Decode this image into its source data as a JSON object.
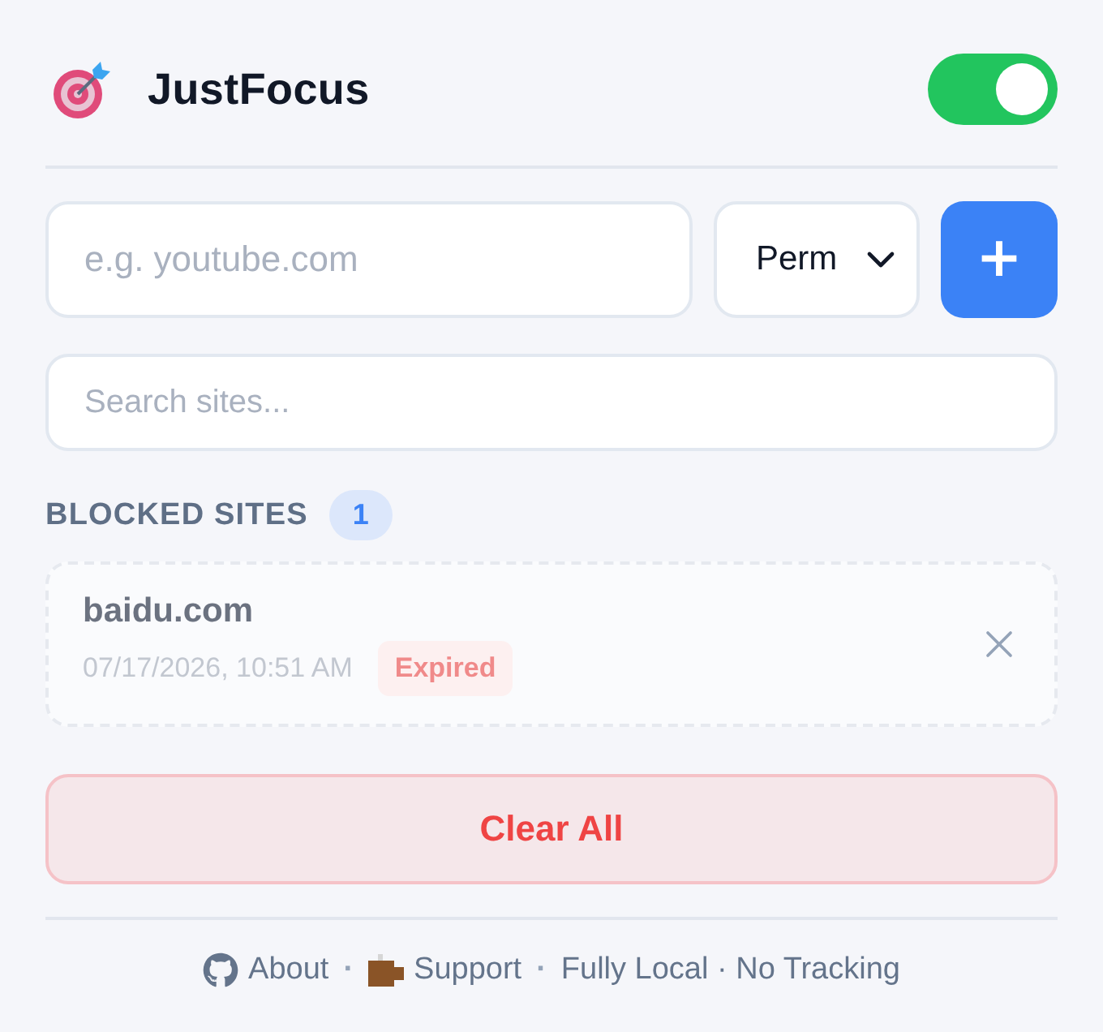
{
  "header": {
    "title": "JustFocus",
    "enabled": true
  },
  "add_form": {
    "site_field": {
      "placeholder": "e.g. youtube.com"
    },
    "duration_select": {
      "value": "Perm"
    },
    "add_button": {
      "label": "+"
    }
  },
  "search": {
    "placeholder": "Search sites..."
  },
  "blocked_sites": {
    "heading": "BLOCKED SITES",
    "count": "1",
    "items": [
      {
        "domain": "baidu.com",
        "time": "07/17/2026, 10:51 AM",
        "status": "Expired",
        "expired": true
      }
    ]
  },
  "clear_button": {
    "label": "Clear All"
  },
  "footer": {
    "items": [
      {
        "kind": "repo",
        "label": "About"
      },
      {
        "kind": "separator",
        "text": "·"
      },
      {
        "kind": "donate",
        "label": "Support"
      },
      {
        "kind": "separator",
        "text": "·"
      },
      {
        "kind": "note",
        "text": "Fully Local · No Tracking"
      }
    ]
  }
}
